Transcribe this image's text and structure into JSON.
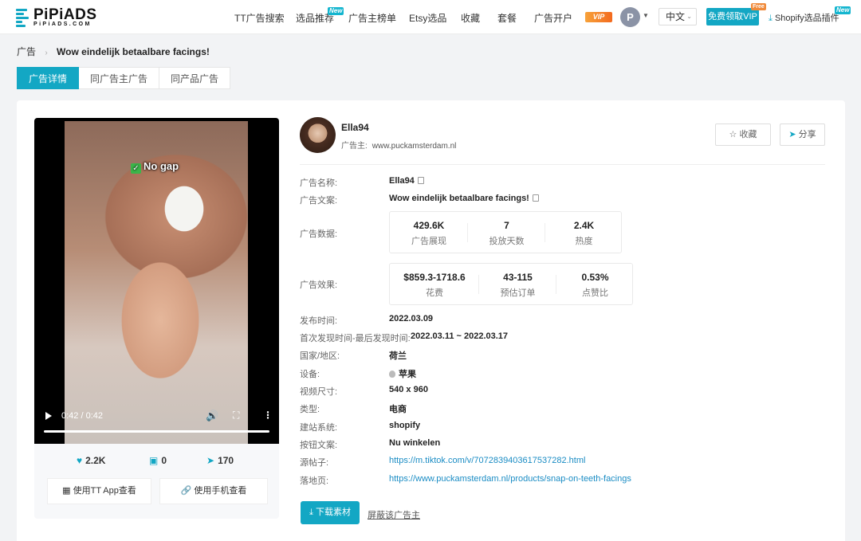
{
  "header": {
    "logo_text": "PiPiADS",
    "logo_sub": "PiPiADS.COM",
    "nav": [
      {
        "label": "TT广告搜索"
      },
      {
        "label": "选品推荐",
        "badge": "New"
      },
      {
        "label": "广告主榜单"
      },
      {
        "label": "Etsy选品"
      },
      {
        "label": "收藏"
      },
      {
        "label": "套餐"
      },
      {
        "label": "广告开户"
      }
    ],
    "vip_badge": "VIP",
    "avatar_letter": "P",
    "language": "中文",
    "free_vip": "免费领取VIP",
    "free_tag": "Free",
    "shopify_plugin": "Shopify选品插件",
    "shopify_badge": "New"
  },
  "breadcrumb": {
    "root": "广告",
    "current": "Wow eindelijk betaalbare facings!"
  },
  "tabs": [
    {
      "label": "广告详情",
      "active": true
    },
    {
      "label": "同广告主广告",
      "active": false
    },
    {
      "label": "同产品广告",
      "active": false
    }
  ],
  "video": {
    "caption": "No gap",
    "time": "0:42 / 0:42",
    "progress": 1.0
  },
  "engagement": {
    "likes": "2.2K",
    "comments": "0",
    "shares": "170"
  },
  "view_buttons": {
    "app": "使用TT App查看",
    "mobile": "使用手机查看"
  },
  "advertiser": {
    "name": "Ella94",
    "label": "广告主:",
    "site": "www.puckamsterdam.nl"
  },
  "actions": {
    "favorite": "收藏",
    "share": "分享"
  },
  "details": {
    "ad_name_label": "广告名称:",
    "ad_name": "Ella94",
    "ad_copy_label": "广告文案:",
    "ad_copy": "Wow eindelijk betaalbare facings!",
    "ad_data_label": "广告数据:",
    "ad_data": [
      {
        "value": "429.6K",
        "label": "广告展现"
      },
      {
        "value": "7",
        "label": "投放天数"
      },
      {
        "value": "2.4K",
        "label": "热度"
      }
    ],
    "ad_effect_label": "广告效果:",
    "ad_effect": [
      {
        "value": "$859.3-1718.6",
        "label": "花费"
      },
      {
        "value": "43-115",
        "label": "预估订单"
      },
      {
        "value": "0.53%",
        "label": "点赞比"
      }
    ],
    "publish_label": "发布时间:",
    "publish": "2022.03.09",
    "seen_label": "首次发现时间-最后发现时间:",
    "seen": "2022.03.11 ~ 2022.03.17",
    "country_label": "国家/地区:",
    "country": "荷兰",
    "device_label": "设备:",
    "device": "苹果",
    "size_label": "视频尺寸:",
    "size": "540 x 960",
    "type_label": "类型:",
    "type": "电商",
    "platform_label": "建站系统:",
    "platform": "shopify",
    "cta_label": "按钮文案:",
    "cta": "Nu winkelen",
    "source_label": "源帖子:",
    "source": "https://m.tiktok.com/v/7072839403617537282.html",
    "landing_label": "落地页:",
    "landing": "https://www.puckamsterdam.nl/products/snap-on-teeth-facings"
  },
  "footer_actions": {
    "download": "下载素材",
    "block": "屏蔽该广告主"
  },
  "colors": {
    "accent": "#13a7c4",
    "link": "#1a8cc4"
  }
}
